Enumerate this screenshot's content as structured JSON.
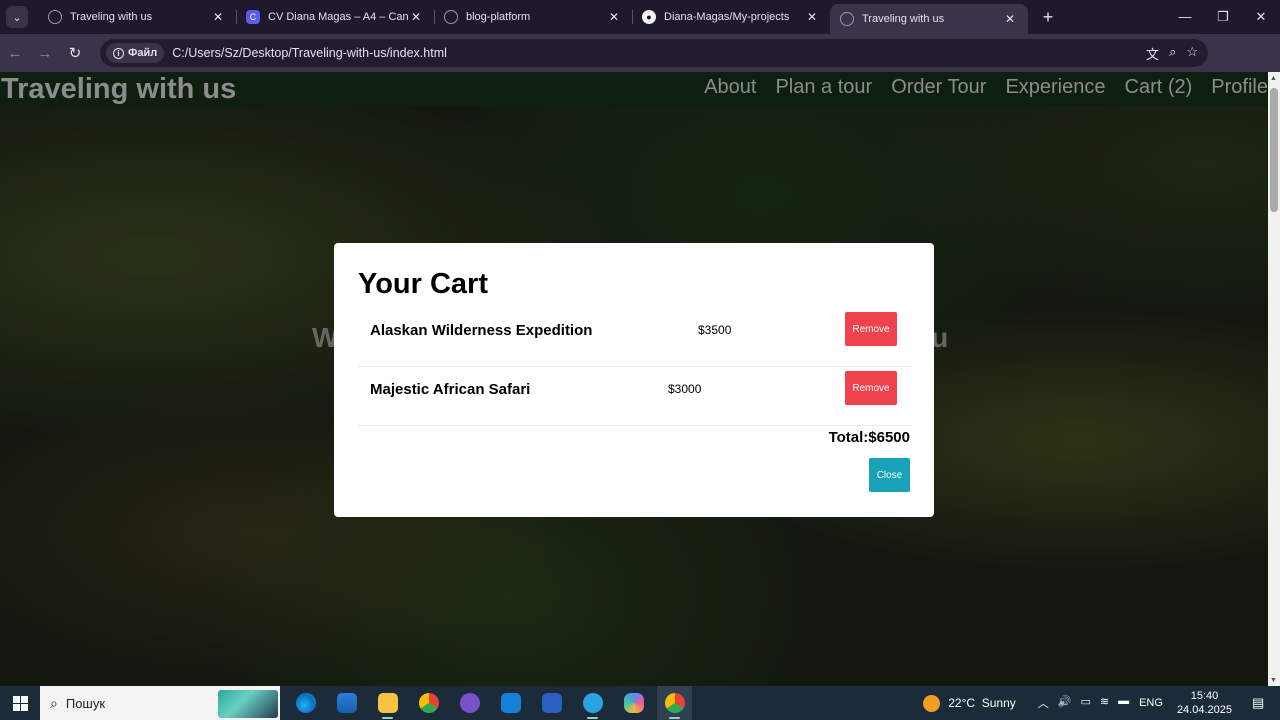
{
  "browser": {
    "tabs": [
      {
        "title": "Traveling with us",
        "icon": "globe-icon"
      },
      {
        "title": "CV Diana Magas – A4 – Canva",
        "icon": "canva-icon"
      },
      {
        "title": "blog-platform",
        "icon": "globe-icon"
      },
      {
        "title": "Diana-Magas/My-projects",
        "icon": "github-icon"
      },
      {
        "title": "Traveling with us",
        "icon": "globe-icon",
        "active": true
      }
    ],
    "site_chip": "Файл",
    "url": "C:/Users/Sz/Desktop/Traveling-with-us/index.html"
  },
  "site": {
    "logo": "Traveling with us",
    "nav": [
      "About",
      "Plan a tour",
      "Order Tour",
      "Experience",
      "Cart (2)",
      "Profile"
    ],
    "hero_left": "W",
    "hero_right": "ou"
  },
  "cart": {
    "title": "Your Cart",
    "items": [
      {
        "name": "Alaskan Wilderness Expedition",
        "price": "$3500",
        "remove_label": "Remove"
      },
      {
        "name": "Majestic African Safari",
        "price": "$3000",
        "remove_label": "Remove"
      }
    ],
    "total": "Total:$6500",
    "close_label": "Close"
  },
  "taskbar": {
    "search_placeholder": "Пошук",
    "temperature": "22°C",
    "weather": "Sunny",
    "language": "ENG",
    "time": "15:40",
    "date": "24.04.2025"
  },
  "colors": {
    "remove_button": "#ee434d",
    "close_button": "#17a2b8",
    "header_bg": "#0e1f10",
    "browser_frame": "#3b3349"
  }
}
